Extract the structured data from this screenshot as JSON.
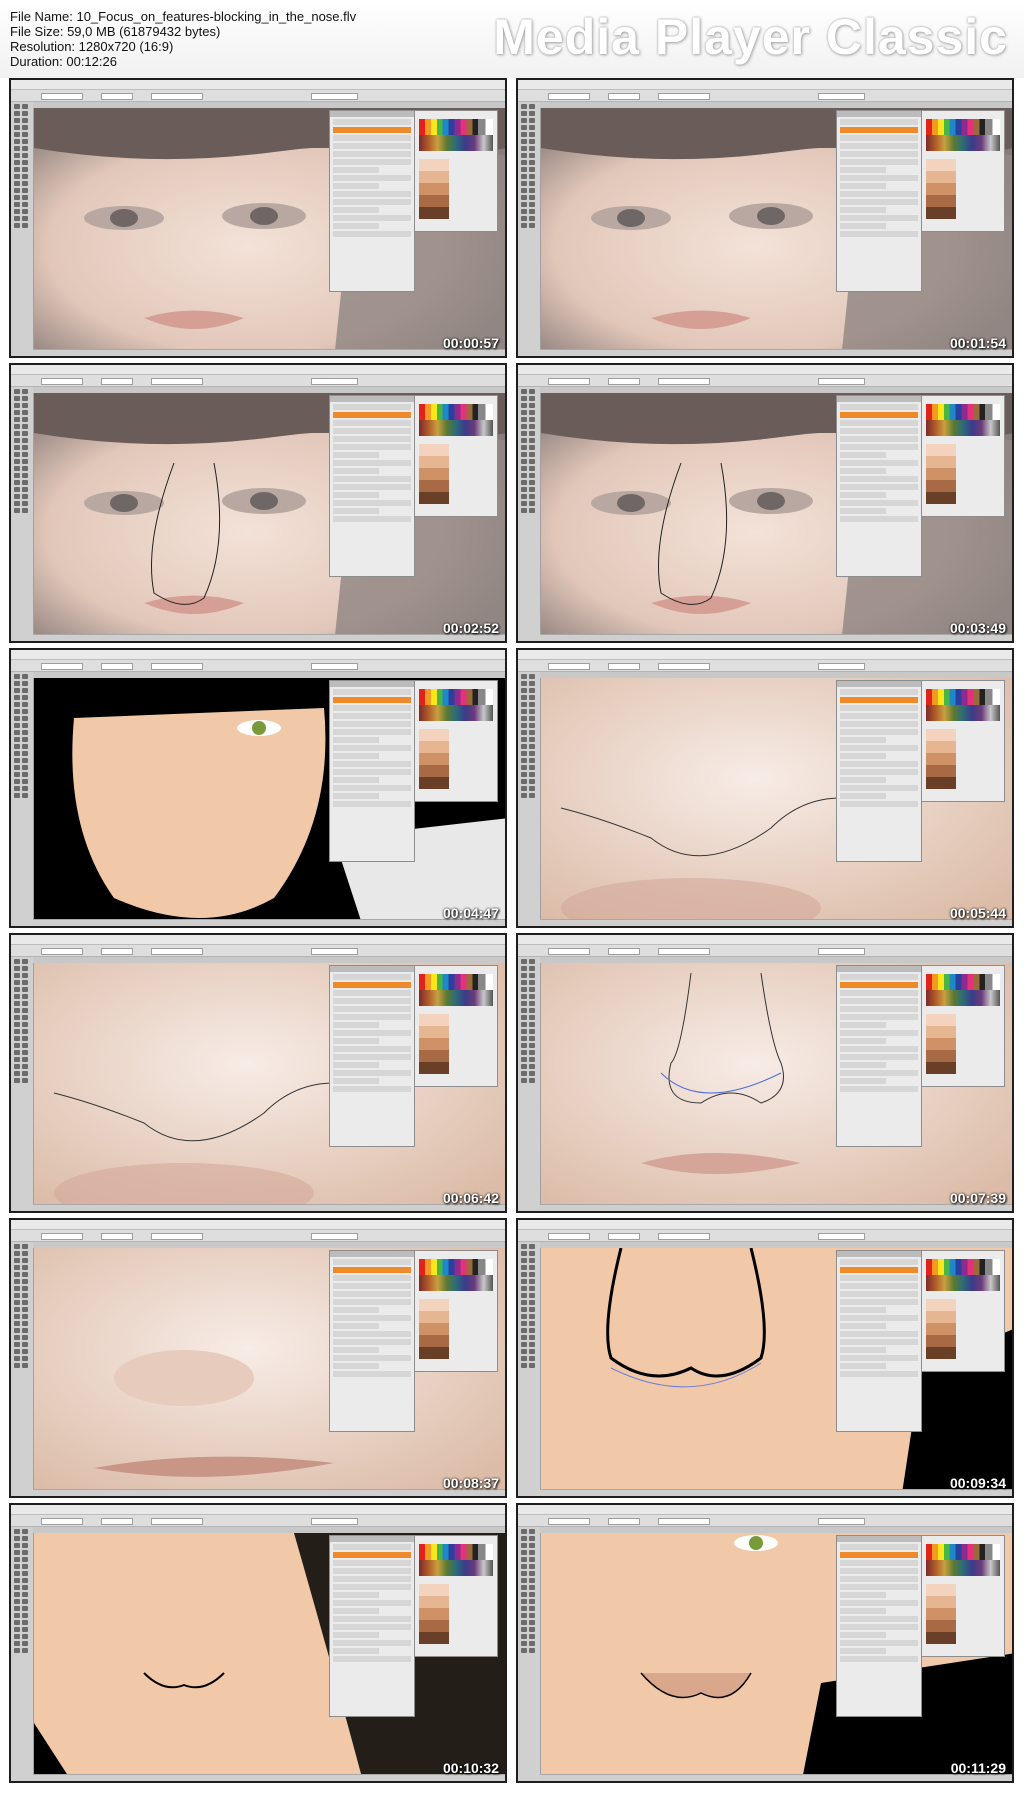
{
  "file_info": {
    "file_name": "File Name: 10_Focus_on_features-blocking_in_the_nose.flv",
    "file_size": "File Size: 59,0 MB (61879432 bytes)",
    "resolution": "Resolution: 1280x720 (16:9)",
    "duration": "Duration: 00:12:26"
  },
  "brand": "Media Player Classic",
  "thumbnails": [
    {
      "timestamp": "00:00:57",
      "scene": "photo-face"
    },
    {
      "timestamp": "00:01:54",
      "scene": "photo-face"
    },
    {
      "timestamp": "00:02:52",
      "scene": "photo-face-nose-path"
    },
    {
      "timestamp": "00:03:49",
      "scene": "photo-face-nose-path"
    },
    {
      "timestamp": "00:04:47",
      "scene": "flat-face"
    },
    {
      "timestamp": "00:05:44",
      "scene": "nose-closeup-path"
    },
    {
      "timestamp": "00:06:42",
      "scene": "nose-closeup-path"
    },
    {
      "timestamp": "00:07:39",
      "scene": "nose-path-selected"
    },
    {
      "timestamp": "00:08:37",
      "scene": "nose-photo"
    },
    {
      "timestamp": "00:09:34",
      "scene": "flat-nose-stroke"
    },
    {
      "timestamp": "00:10:32",
      "scene": "flat-nose-small"
    },
    {
      "timestamp": "00:11:29",
      "scene": "flat-nose-shaded"
    }
  ]
}
